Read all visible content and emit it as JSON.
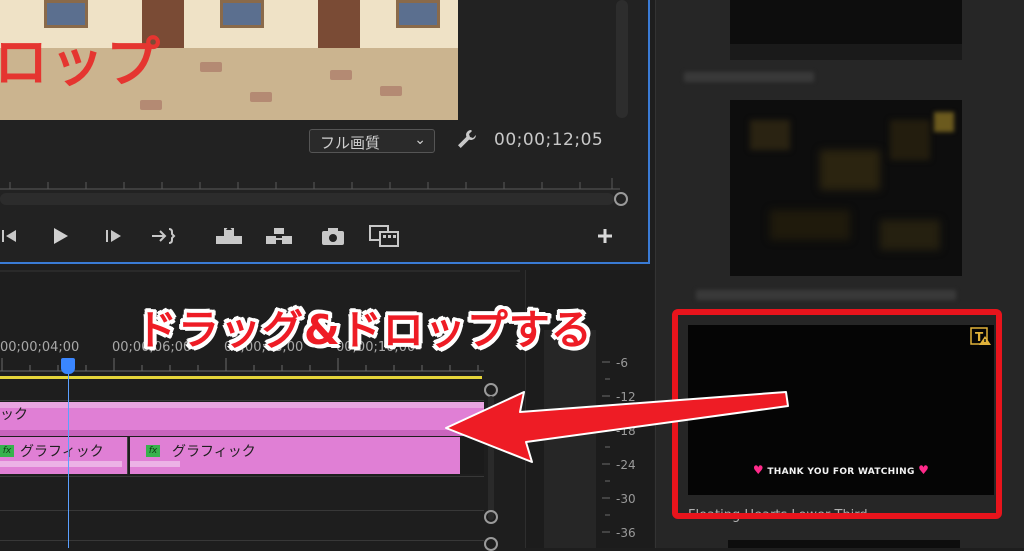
{
  "monitor": {
    "video_overlay_text": "ロップ",
    "quality_select": {
      "value": "フル画質"
    },
    "timecode": "00;00;12;05",
    "controls": [
      "step-back-icon",
      "play-icon",
      "step-forward-icon",
      "go-to-out-icon",
      "lift-icon",
      "extract-icon",
      "camera-icon",
      "compare-icon",
      "add-icon"
    ]
  },
  "timeline": {
    "time_labels": [
      "00;00;04;00",
      "00;00;06;00",
      "00;00;08;00",
      "00;00;10;00"
    ],
    "playhead_icon": "playhead-marker",
    "tracks": {
      "v2_clip_label": "ック",
      "v1_clips": [
        {
          "badge": "fx",
          "label": "グラフィック"
        },
        {
          "badge": "fx",
          "label": "グラフィック"
        }
      ]
    }
  },
  "audio_meter": {
    "scale": [
      "-6",
      "-12",
      "-18",
      "-24",
      "-30",
      "-36"
    ]
  },
  "essential_graphics": {
    "selected_template": {
      "preview_text": "THANK YOU FOR WATCHING",
      "heart_glyph": "♥",
      "name": "Floating Hearts Lower Third",
      "warning_icon": "text-warning-icon"
    }
  },
  "annotation": {
    "instruction_text": "ドラッグ&ドロップする",
    "arrow_icon": "drag-arrow",
    "color": "#ee1c25"
  },
  "colors": {
    "accent_blue": "#3a7bd5",
    "clip_pink": "#e07fd5",
    "work_area_yellow": "#e6d53a",
    "highlight_red": "#e8141c"
  }
}
